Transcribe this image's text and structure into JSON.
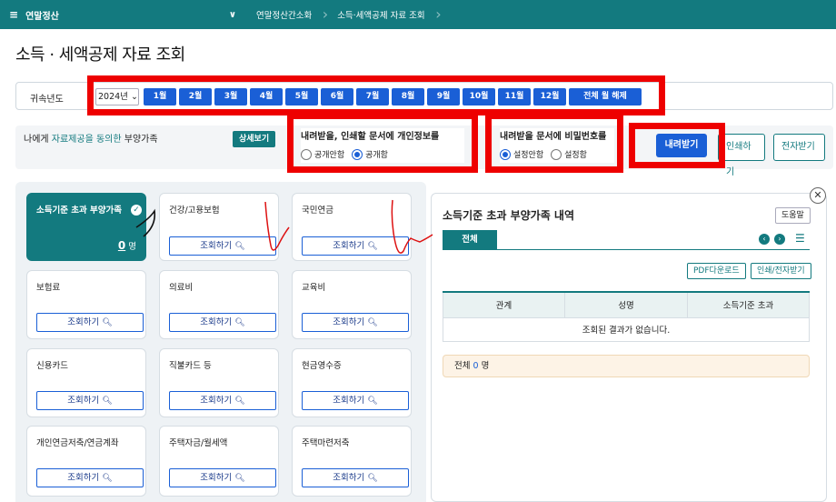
{
  "topbar": {
    "menu_label": "연말정산",
    "breadcrumbs": [
      "연말정산간소화",
      "소득·세액공제 자료 조회"
    ]
  },
  "page_title": "소득 · 세액공제 자료 조회",
  "yearbar": {
    "label": "귀속년도",
    "year_value": "2024년",
    "months": [
      "1월",
      "2월",
      "3월",
      "4월",
      "5월",
      "6월",
      "7월",
      "8월",
      "9월",
      "10월",
      "11월",
      "12월"
    ],
    "all_months": "전체 월 해제"
  },
  "options": {
    "consent_prefix": "나에게 ",
    "consent_highlight": "자료제공을 동의한",
    "consent_suffix": " 부양가족",
    "detail_button": "상세보기",
    "privacy_title": "내려받을, 인쇄할 문서에 개인정보를",
    "privacy_options": [
      "공개안함",
      "공개함"
    ],
    "privacy_selected": "공개함",
    "password_title": "내려받을 문서에 비밀번호를",
    "password_options": [
      "설정안함",
      "설정함"
    ],
    "password_selected": "설정안함",
    "download_button": "내려받기",
    "print_button": "인쇄하기",
    "send_button": "전자받기"
  },
  "cards": [
    {
      "title": "소득기준 초과 부양가족",
      "selected": true,
      "count": "0",
      "unit": "명"
    },
    {
      "title": "건강/고용보험",
      "button": "조회하기"
    },
    {
      "title": "국민연금",
      "button": "조회하기"
    },
    {
      "title": "보험료",
      "button": "조회하기"
    },
    {
      "title": "의료비",
      "button": "조회하기"
    },
    {
      "title": "교육비",
      "button": "조회하기"
    },
    {
      "title": "신용카드",
      "button": "조회하기"
    },
    {
      "title": "직불카드 등",
      "button": "조회하기"
    },
    {
      "title": "현금영수증",
      "button": "조회하기"
    },
    {
      "title": "개인연금저축/연금계좌",
      "button": "조회하기"
    },
    {
      "title": "주택자금/월세액",
      "button": "조회하기"
    },
    {
      "title": "주택마련저축",
      "button": "조회하기"
    }
  ],
  "detail": {
    "title": "소득기준 초과 부양가족 내역",
    "help_button": "도움말",
    "tab_all": "전체",
    "pdf_button": "PDF다운로드",
    "print_button": "인쇄/전자받기",
    "columns": [
      "관계",
      "성명",
      "소득기준 초과"
    ],
    "empty_message": "조회된 결과가 없습니다.",
    "total_label": "전체",
    "total_count": "0",
    "total_unit": "명"
  },
  "colors": {
    "teal": "#137a7f",
    "blue": "#1a5fd6",
    "annotation_red": "#ee0000"
  },
  "icons": [
    "menu-icon",
    "chevron-down-icon",
    "check-icon",
    "search-icon",
    "close-icon",
    "prev-icon",
    "next-icon",
    "list-icon"
  ]
}
